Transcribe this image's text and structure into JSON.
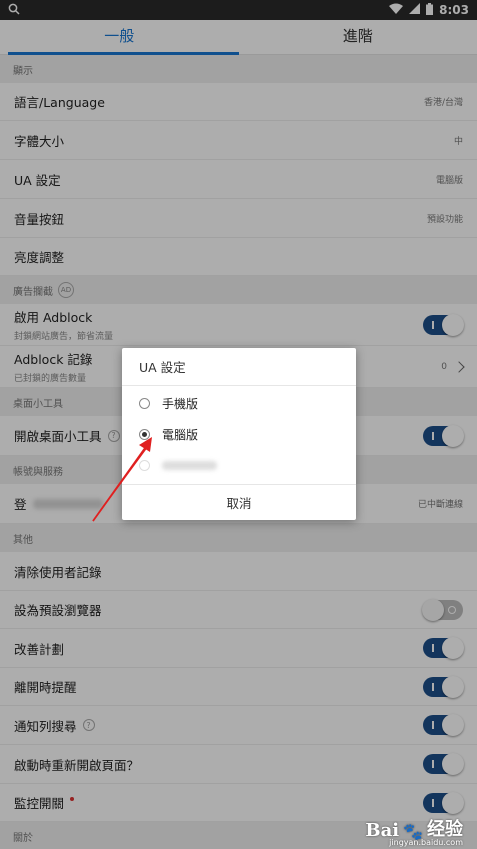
{
  "status_bar": {
    "time": "8:03"
  },
  "tabs": [
    {
      "label": "一般",
      "active": true
    },
    {
      "label": "進階",
      "active": false
    }
  ],
  "sections": {
    "display": "顯示",
    "adblock": "廣告攔截",
    "ad_badge": "AD",
    "desktop_widget": "桌面小工具",
    "account": "帳號與服務",
    "other": "其他",
    "about": "關於"
  },
  "rows": {
    "language": {
      "label": "語言/Language",
      "value": "香港/台灣"
    },
    "font_size": {
      "label": "字體大小",
      "value": "中"
    },
    "ua": {
      "label": "UA 設定",
      "value": "電腦版"
    },
    "volume": {
      "label": "音量按鈕",
      "value": "預設功能"
    },
    "brightness": {
      "label": "亮度調整"
    },
    "enable_adblock": {
      "label": "啟用 Adblock",
      "sub": "封鎖網站廣告，節省流量",
      "toggle": true
    },
    "adblock_log": {
      "label": "Adblock 記錄",
      "sub": "已封鎖的廣告數量",
      "value": "0"
    },
    "desktop_widget": {
      "label": "開啟桌面小工具",
      "toggle": true
    },
    "account": {
      "label": "登",
      "value": "已中斷連線"
    },
    "clear_history": {
      "label": "清除使用者記錄"
    },
    "default_browser": {
      "label": "設為預設瀏覽器",
      "toggle": false
    },
    "improve": {
      "label": "改善計劃",
      "toggle": true
    },
    "exit_remind": {
      "label": "離開時提醒",
      "toggle": true
    },
    "notify_search": {
      "label": "通知列搜尋",
      "toggle": true
    },
    "reopen_pages": {
      "label": "啟動時重新開啟頁面？",
      "toggle": true
    },
    "monitor_switch": {
      "label": "監控開關",
      "toggle": true
    }
  },
  "dialog": {
    "title": "UA 設定",
    "options": [
      {
        "label": "手機版",
        "checked": false
      },
      {
        "label": "電腦版",
        "checked": true
      }
    ],
    "cancel": "取消"
  },
  "watermark": {
    "logo": "Bai",
    "text": "经验",
    "site": "jingyan.baidu.com"
  },
  "colors": {
    "accent": "#1976d2",
    "toggle_on": "#1d4f8a",
    "arrow": "#e02020"
  }
}
